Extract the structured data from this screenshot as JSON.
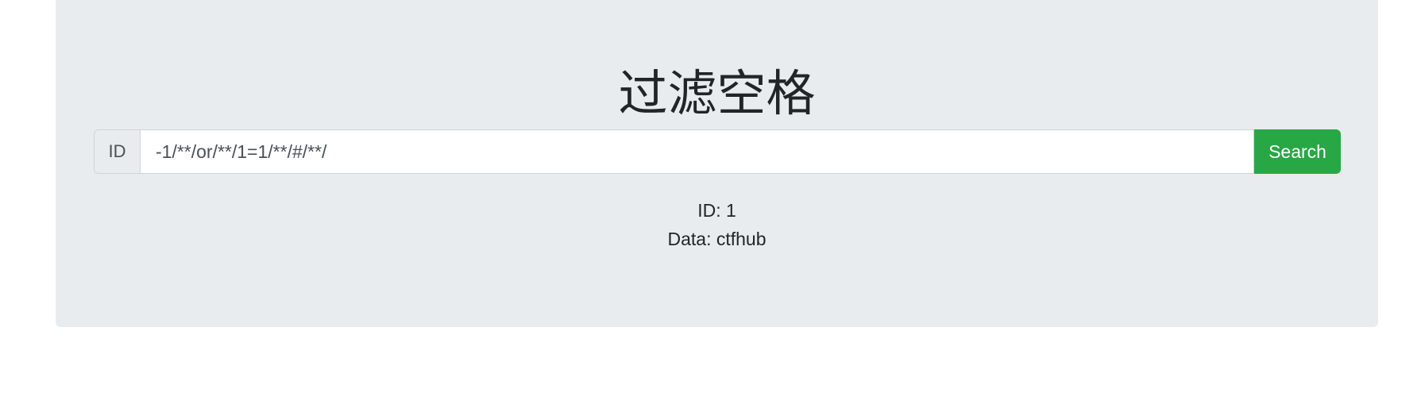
{
  "page": {
    "title": "过滤空格"
  },
  "search": {
    "prepend_label": "ID",
    "value": "-1/**/or/**/1=1/**/#/**/",
    "button_label": "Search"
  },
  "result": {
    "id_line": "ID: 1",
    "data_line": "Data: ctfhub"
  }
}
